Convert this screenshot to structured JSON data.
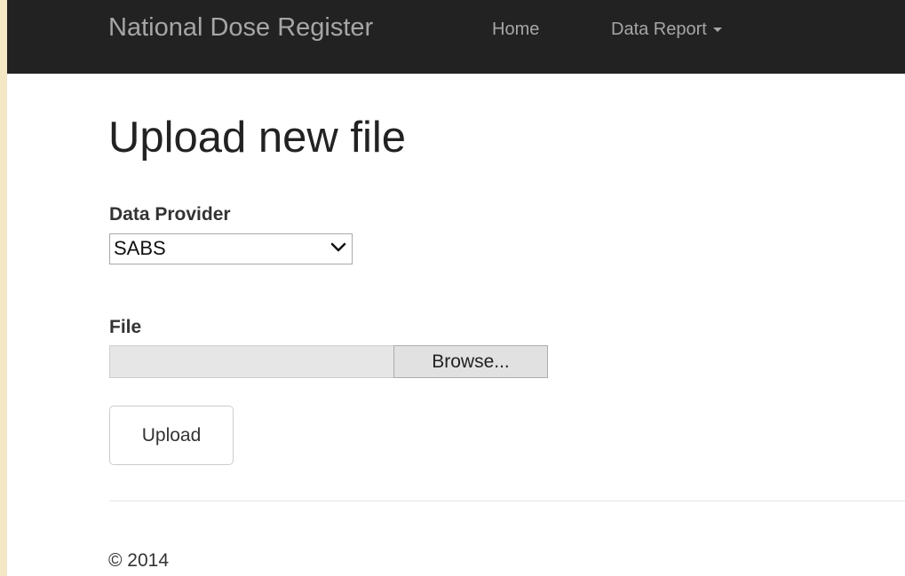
{
  "navbar": {
    "brand": "National Dose Register",
    "links": [
      {
        "label": "Home"
      },
      {
        "label": "Data Report"
      }
    ],
    "caret_icon": "caret-down-icon",
    "background_color": "#222222",
    "link_color": "#a6a6a6"
  },
  "page": {
    "title": "Upload new file"
  },
  "form": {
    "provider_label": "Data Provider",
    "provider_selected": "SABS",
    "provider_chevron_icon": "chevron-down-icon",
    "file_label": "File",
    "file_value": "",
    "browse_label": "Browse...",
    "upload_label": "Upload"
  },
  "footer": {
    "text": "© 2014"
  }
}
